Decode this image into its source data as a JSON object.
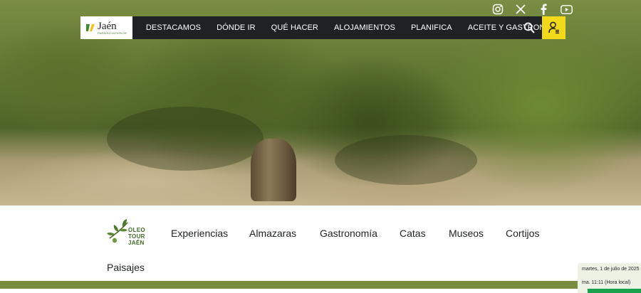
{
  "site": {
    "logo_title": "Jaén",
    "logo_subtitle": "PARAÍSO INTERIOR"
  },
  "social": [
    "instagram-icon",
    "x-icon",
    "facebook-icon",
    "youtube-icon"
  ],
  "nav": {
    "items": [
      {
        "label": "DESTACAMOS"
      },
      {
        "label": "DÓNDE IR"
      },
      {
        "label": "QUÉ HACER"
      },
      {
        "label": "ALOJAMIENTOS"
      },
      {
        "label": "PLANIFICA"
      },
      {
        "label": "ACEITE Y GASTRONOMÍA"
      }
    ],
    "search_icon": "search-icon",
    "user_icon": "user-icon"
  },
  "oleotour": {
    "logo_lines": [
      "OLEO",
      "TOUR",
      "JAÉN"
    ],
    "items": [
      {
        "label": "Experiencias"
      },
      {
        "label": "Almazaras"
      },
      {
        "label": "Gastronomía"
      },
      {
        "label": "Catas"
      },
      {
        "label": "Museos"
      },
      {
        "label": "Cortijos"
      },
      {
        "label": "Paisajes"
      }
    ]
  },
  "clock": {
    "date": "martes, 1 de julio de 2025",
    "time": "ma. 11:11 (Hora local)"
  },
  "colors": {
    "nav_bg": "#1f2224",
    "user_button": "#f2d91a",
    "olive_bar": "#7a8c3e",
    "clock_accent": "#1aa14d"
  }
}
